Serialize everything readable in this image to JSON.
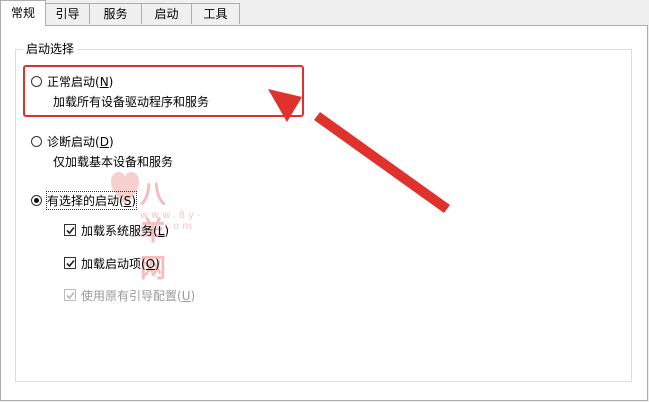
{
  "tabs": [
    {
      "label": "常规",
      "active": true
    },
    {
      "label": "引导",
      "active": false
    },
    {
      "label": "服务",
      "active": false
    },
    {
      "label": "启动",
      "active": false
    },
    {
      "label": "工具",
      "active": false
    }
  ],
  "startup_group": {
    "title": "启动选择",
    "normal": {
      "label": "正常启动(",
      "key": "N",
      "suffix": ")",
      "desc": "加载所有设备驱动程序和服务",
      "selected": false
    },
    "diagnostic": {
      "label": "诊断启动(",
      "key": "D",
      "suffix": ")",
      "desc": "仅加载基本设备和服务",
      "selected": false
    },
    "selective": {
      "label": "有选择的启动(",
      "key": "S",
      "suffix": ")",
      "selected": true,
      "options": [
        {
          "label": "加载系统服务(",
          "key": "L",
          "suffix": ")",
          "checked": true,
          "disabled": false
        },
        {
          "label": "加载启动项(",
          "key": "O",
          "suffix": ")",
          "checked": true,
          "disabled": false
        },
        {
          "label": "使用原有引导配置(",
          "key": "U",
          "suffix": ")",
          "checked": true,
          "disabled": true
        }
      ]
    }
  },
  "watermark": {
    "title": "八羊网",
    "url": "www.8y-ad.com"
  },
  "colors": {
    "annotation": "#e0322c",
    "watermark": "#f3b7b7"
  }
}
